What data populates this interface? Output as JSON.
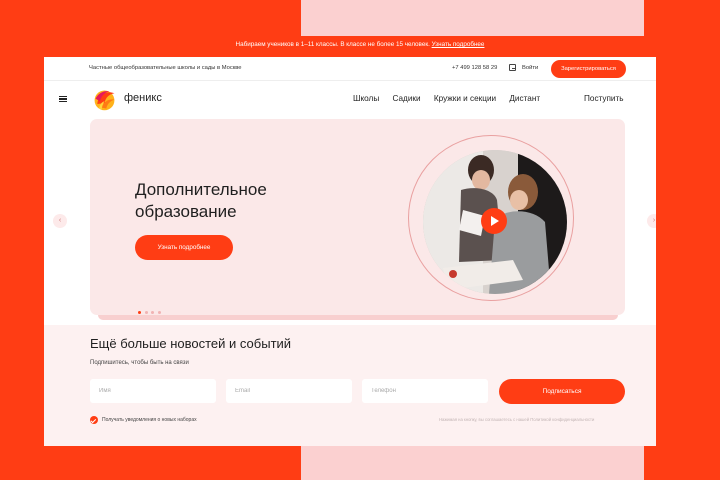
{
  "announcement": {
    "text": "Набираем учеников в 1–11 классы. В классе не более 15 человек.",
    "link": "Узнать подробнее"
  },
  "topbar": {
    "tagline": "Частные общеобразовательные школы и сады в Москве",
    "phone": "+7 499 128 58 29",
    "login_label": "Войти",
    "register_label": "Зарегистрироваться"
  },
  "nav": {
    "logo_text": "феникс",
    "items": [
      "Школы",
      "Садики",
      "Кружки и секции",
      "Дистант"
    ],
    "apply_label": "Поступить"
  },
  "hero": {
    "title_line1": "Дополнительное",
    "title_line2": "образование",
    "cta_label": "Узнать подробнее",
    "slide_count": 4,
    "active_slide": 1
  },
  "newsletter": {
    "heading": "Ещё больше новостей и событий",
    "subheading": "Подпишитесь, чтобы быть на связи",
    "name_placeholder": "Имя",
    "email_placeholder": "Email",
    "phone_placeholder": "Телефон",
    "subscribe_label": "Подписаться",
    "consent_label": "Получать уведомления о новых наборах",
    "legal_text": "Нажимая на кнопку, вы соглашаетесь с нашей Политикой конфиденциальности"
  },
  "colors": {
    "accent": "#ff3d14",
    "hero_bg": "#fbe8e8",
    "pink": "#fbd0d0"
  }
}
